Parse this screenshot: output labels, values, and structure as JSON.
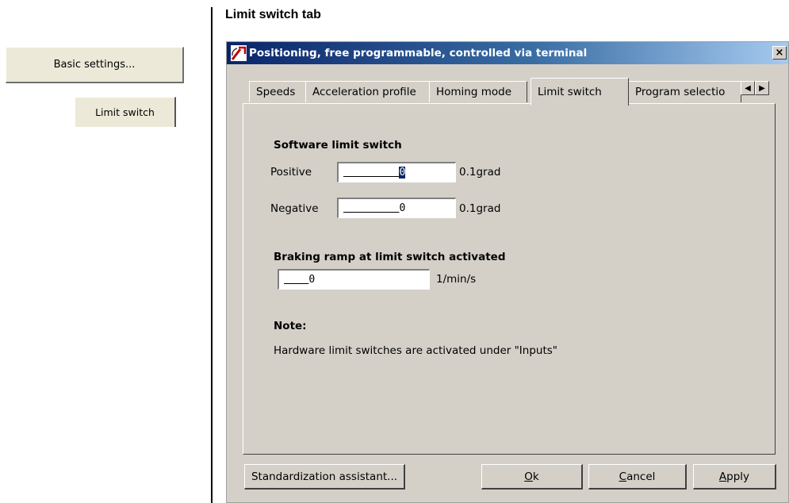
{
  "left": {
    "basic_settings_label": "Basic settings...",
    "limit_switch_tab_label": "Limit switch"
  },
  "heading": "Limit switch tab",
  "dialog": {
    "title": "Positioning, free programmable, controlled via terminal",
    "close_glyph": "×",
    "tabs": [
      {
        "label": "Speeds"
      },
      {
        "label": "Acceleration profile"
      },
      {
        "label": "Homing mode"
      },
      {
        "label": "Limit switch",
        "active": true
      },
      {
        "label": "Program selectio"
      }
    ],
    "tab_scroll_left": "◀",
    "tab_scroll_right": "▶",
    "software_limit": {
      "title": "Software limit switch",
      "positive_label": "Positive",
      "positive_value": "0",
      "negative_label": "Negative",
      "negative_value": "0",
      "unit": "0.1grad"
    },
    "braking": {
      "title": "Braking ramp at limit switch activated",
      "value": "0",
      "unit": "1/min/s"
    },
    "note": {
      "title": "Note:",
      "text": "Hardware limit switches are activated under \"Inputs\""
    },
    "buttons": {
      "standardization": "Standardization assistant...",
      "ok_mnemonic": "O",
      "ok_rest": "k",
      "cancel_mnemonic": "C",
      "cancel_rest": "ancel",
      "apply_mnemonic": "A",
      "apply_rest": "pply"
    }
  }
}
